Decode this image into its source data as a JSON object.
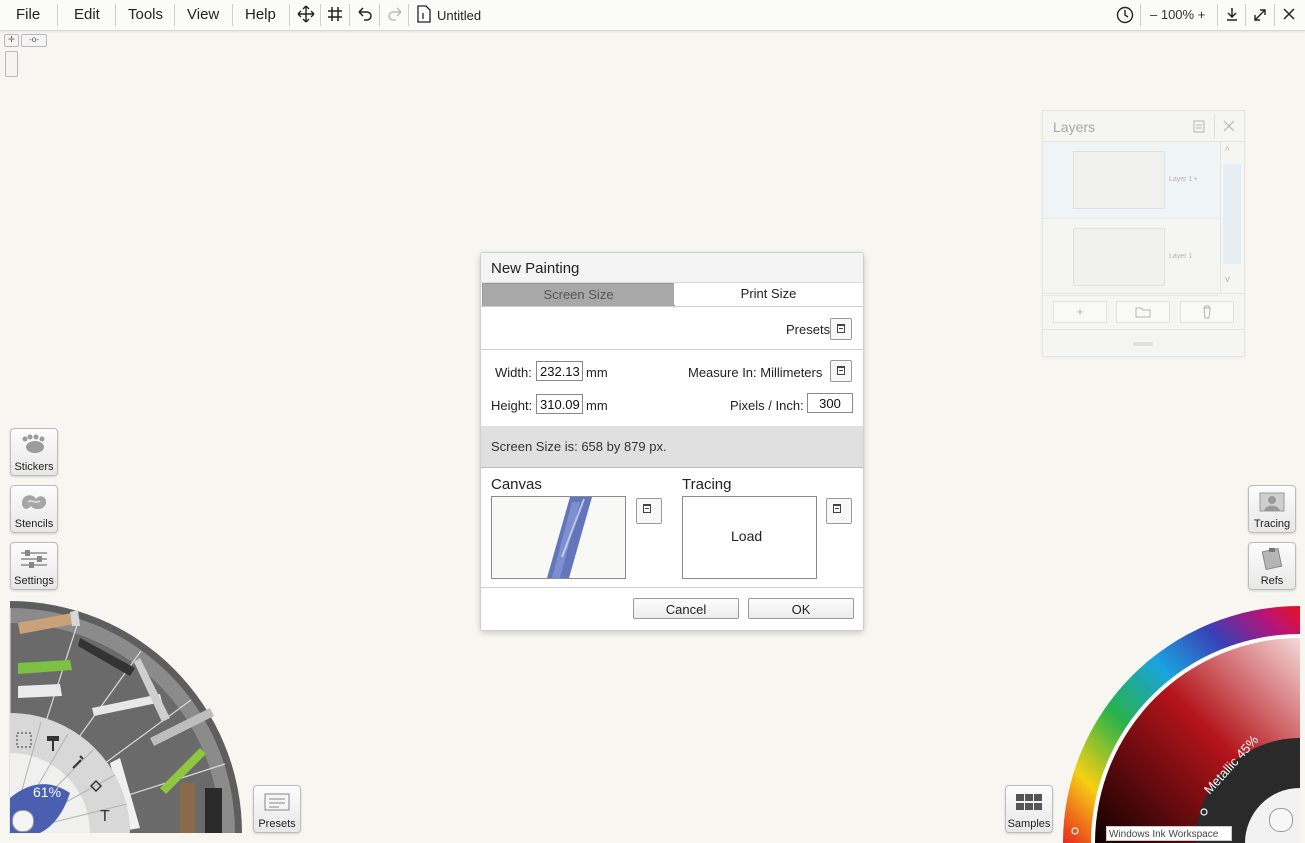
{
  "menubar": {
    "items": [
      "File",
      "Edit",
      "Tools",
      "View",
      "Help"
    ],
    "document_title": "Untitled",
    "zoom": "100%",
    "icons": [
      "move-icon",
      "grid-icon",
      "undo-icon",
      "redo-icon",
      "document-icon",
      "clock-icon",
      "download-icon",
      "fullscreen-icon",
      "close-icon"
    ]
  },
  "layers_panel": {
    "title": "Layers",
    "layers": [
      {
        "label": "Layer 1 •"
      },
      {
        "label": "Layer 1"
      }
    ],
    "buttons": [
      "add-icon",
      "folder-icon",
      "trash-icon"
    ]
  },
  "dialog": {
    "title": "New Painting",
    "tabs": [
      {
        "label": "Screen Size",
        "active": false
      },
      {
        "label": "Print Size",
        "active": true
      }
    ],
    "presets_label": "Presets",
    "width_label": "Width:",
    "width_value": "232.13",
    "width_unit": "mm",
    "height_label": "Height:",
    "height_value": "310.09",
    "height_unit": "mm",
    "measure_label": "Measure In: Millimeters",
    "ppi_label": "Pixels / Inch:",
    "ppi_value": "300",
    "screen_size_text": "Screen Size is: 658 by 879 px.",
    "canvas_label": "Canvas",
    "tracing_label": "Tracing",
    "load_label": "Load",
    "cancel_label": "Cancel",
    "ok_label": "OK"
  },
  "left_tools": [
    {
      "label": "Stickers"
    },
    {
      "label": "Stencils"
    },
    {
      "label": "Settings"
    }
  ],
  "right_tools": [
    {
      "label": "Tracing"
    },
    {
      "label": "Refs"
    }
  ],
  "tool_wheel": {
    "brush_size": "61%"
  },
  "bottom_buttons": {
    "presets_label": "Presets",
    "samples_label": "Samples"
  },
  "color_wheel": {
    "metallic_label": "Metallic 45%"
  },
  "ink_workspace_label": "Windows Ink Workspace",
  "colors": {
    "accent_blue": "#4a5fb0",
    "tab_inactive": "#a8a8a8",
    "canvas_bg": "#f7f6f1"
  }
}
